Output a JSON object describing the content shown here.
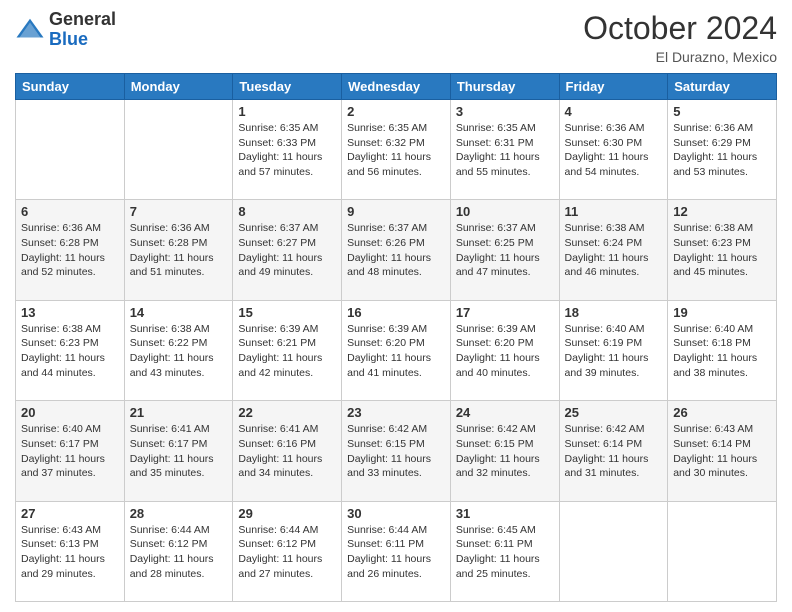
{
  "header": {
    "logo": {
      "general": "General",
      "blue": "Blue"
    },
    "title": "October 2024",
    "location": "El Durazno, Mexico"
  },
  "weekdays": [
    "Sunday",
    "Monday",
    "Tuesday",
    "Wednesday",
    "Thursday",
    "Friday",
    "Saturday"
  ],
  "weeks": [
    [
      null,
      null,
      {
        "day": 1,
        "sunrise": "6:35 AM",
        "sunset": "6:33 PM",
        "daylight": "11 hours and 57 minutes."
      },
      {
        "day": 2,
        "sunrise": "6:35 AM",
        "sunset": "6:32 PM",
        "daylight": "11 hours and 56 minutes."
      },
      {
        "day": 3,
        "sunrise": "6:35 AM",
        "sunset": "6:31 PM",
        "daylight": "11 hours and 55 minutes."
      },
      {
        "day": 4,
        "sunrise": "6:36 AM",
        "sunset": "6:30 PM",
        "daylight": "11 hours and 54 minutes."
      },
      {
        "day": 5,
        "sunrise": "6:36 AM",
        "sunset": "6:29 PM",
        "daylight": "11 hours and 53 minutes."
      }
    ],
    [
      {
        "day": 6,
        "sunrise": "6:36 AM",
        "sunset": "6:28 PM",
        "daylight": "11 hours and 52 minutes."
      },
      {
        "day": 7,
        "sunrise": "6:36 AM",
        "sunset": "6:28 PM",
        "daylight": "11 hours and 51 minutes."
      },
      {
        "day": 8,
        "sunrise": "6:37 AM",
        "sunset": "6:27 PM",
        "daylight": "11 hours and 49 minutes."
      },
      {
        "day": 9,
        "sunrise": "6:37 AM",
        "sunset": "6:26 PM",
        "daylight": "11 hours and 48 minutes."
      },
      {
        "day": 10,
        "sunrise": "6:37 AM",
        "sunset": "6:25 PM",
        "daylight": "11 hours and 47 minutes."
      },
      {
        "day": 11,
        "sunrise": "6:38 AM",
        "sunset": "6:24 PM",
        "daylight": "11 hours and 46 minutes."
      },
      {
        "day": 12,
        "sunrise": "6:38 AM",
        "sunset": "6:23 PM",
        "daylight": "11 hours and 45 minutes."
      }
    ],
    [
      {
        "day": 13,
        "sunrise": "6:38 AM",
        "sunset": "6:23 PM",
        "daylight": "11 hours and 44 minutes."
      },
      {
        "day": 14,
        "sunrise": "6:38 AM",
        "sunset": "6:22 PM",
        "daylight": "11 hours and 43 minutes."
      },
      {
        "day": 15,
        "sunrise": "6:39 AM",
        "sunset": "6:21 PM",
        "daylight": "11 hours and 42 minutes."
      },
      {
        "day": 16,
        "sunrise": "6:39 AM",
        "sunset": "6:20 PM",
        "daylight": "11 hours and 41 minutes."
      },
      {
        "day": 17,
        "sunrise": "6:39 AM",
        "sunset": "6:20 PM",
        "daylight": "11 hours and 40 minutes."
      },
      {
        "day": 18,
        "sunrise": "6:40 AM",
        "sunset": "6:19 PM",
        "daylight": "11 hours and 39 minutes."
      },
      {
        "day": 19,
        "sunrise": "6:40 AM",
        "sunset": "6:18 PM",
        "daylight": "11 hours and 38 minutes."
      }
    ],
    [
      {
        "day": 20,
        "sunrise": "6:40 AM",
        "sunset": "6:17 PM",
        "daylight": "11 hours and 37 minutes."
      },
      {
        "day": 21,
        "sunrise": "6:41 AM",
        "sunset": "6:17 PM",
        "daylight": "11 hours and 35 minutes."
      },
      {
        "day": 22,
        "sunrise": "6:41 AM",
        "sunset": "6:16 PM",
        "daylight": "11 hours and 34 minutes."
      },
      {
        "day": 23,
        "sunrise": "6:42 AM",
        "sunset": "6:15 PM",
        "daylight": "11 hours and 33 minutes."
      },
      {
        "day": 24,
        "sunrise": "6:42 AM",
        "sunset": "6:15 PM",
        "daylight": "11 hours and 32 minutes."
      },
      {
        "day": 25,
        "sunrise": "6:42 AM",
        "sunset": "6:14 PM",
        "daylight": "11 hours and 31 minutes."
      },
      {
        "day": 26,
        "sunrise": "6:43 AM",
        "sunset": "6:14 PM",
        "daylight": "11 hours and 30 minutes."
      }
    ],
    [
      {
        "day": 27,
        "sunrise": "6:43 AM",
        "sunset": "6:13 PM",
        "daylight": "11 hours and 29 minutes."
      },
      {
        "day": 28,
        "sunrise": "6:44 AM",
        "sunset": "6:12 PM",
        "daylight": "11 hours and 28 minutes."
      },
      {
        "day": 29,
        "sunrise": "6:44 AM",
        "sunset": "6:12 PM",
        "daylight": "11 hours and 27 minutes."
      },
      {
        "day": 30,
        "sunrise": "6:44 AM",
        "sunset": "6:11 PM",
        "daylight": "11 hours and 26 minutes."
      },
      {
        "day": 31,
        "sunrise": "6:45 AM",
        "sunset": "6:11 PM",
        "daylight": "11 hours and 25 minutes."
      },
      null,
      null
    ]
  ]
}
